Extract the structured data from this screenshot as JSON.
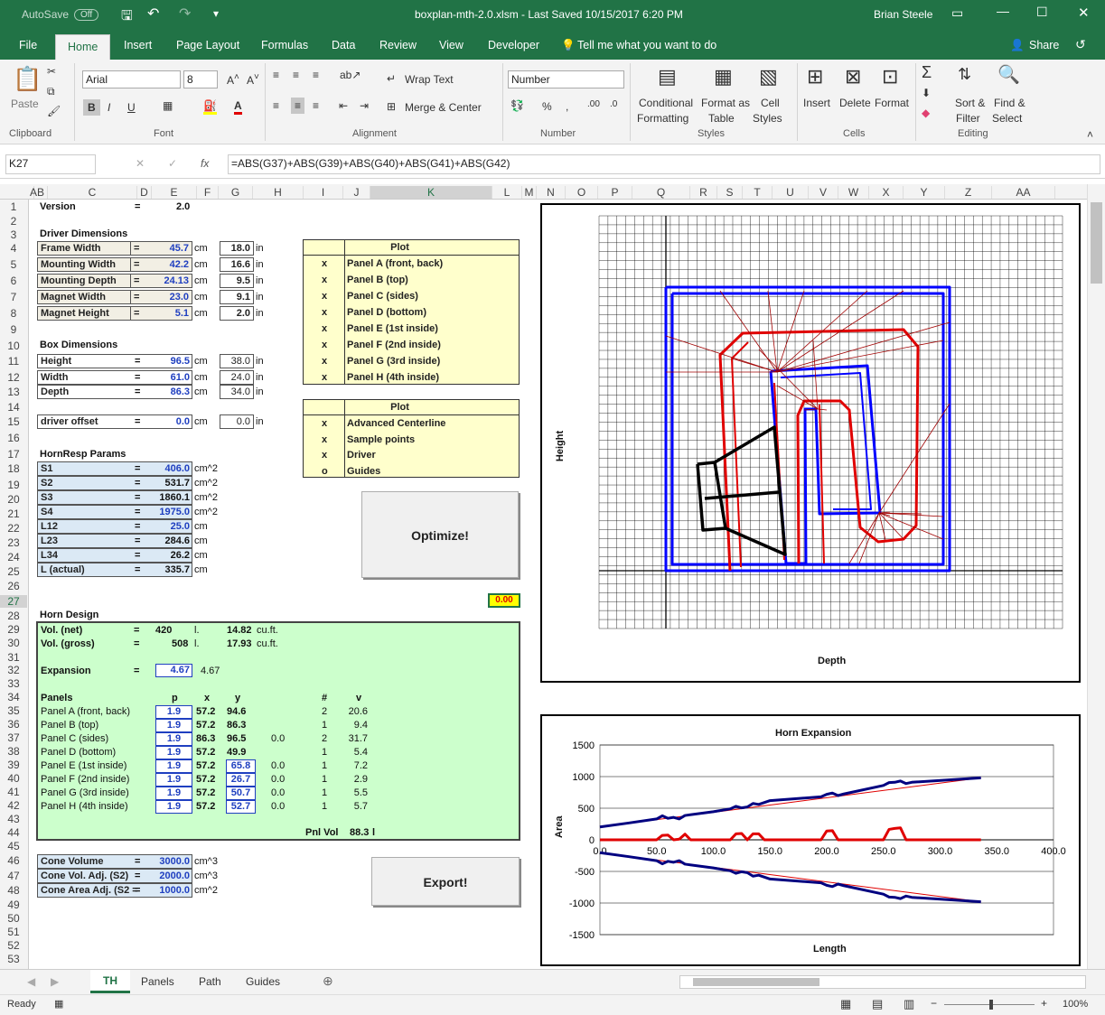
{
  "titlebar": {
    "autosave": "AutoSave",
    "autosave_state": "Off",
    "filename": "boxplan-mth-2.0.xlsm  -  Last Saved 10/15/2017 6:20 PM",
    "user": "Brian Steele"
  },
  "tabs": [
    "File",
    "Home",
    "Insert",
    "Page Layout",
    "Formulas",
    "Data",
    "Review",
    "View",
    "Developer"
  ],
  "tell_me": "Tell me what you want to do",
  "share": "Share",
  "ribbon": {
    "paste": "Paste",
    "font_name": "Arial",
    "font_size": "8",
    "wrap_text": "Wrap Text",
    "merge_center": "Merge & Center",
    "number_format": "Number",
    "conditional": "Conditional",
    "formatting": "Formatting",
    "format_as": "Format as",
    "table": "Table",
    "cell": "Cell",
    "styles_lbl": "Styles",
    "insert": "Insert",
    "delete": "Delete",
    "format": "Format",
    "sort": "Sort &",
    "filter": "Filter",
    "find": "Find &",
    "select": "Select",
    "groups": [
      "Clipboard",
      "Font",
      "Alignment",
      "Number",
      "Styles",
      "Cells",
      "Editing"
    ]
  },
  "formula": {
    "namebox": "K27",
    "fx": "fx",
    "text": "=ABS(G37)+ABS(G39)+ABS(G40)+ABS(G41)+ABS(G42)"
  },
  "columns": [
    "A",
    "B",
    "C",
    "D",
    "E",
    "F",
    "G",
    "H",
    "I",
    "J",
    "K",
    "L",
    "M",
    "N",
    "O",
    "P",
    "Q",
    "R",
    "S",
    "T",
    "U",
    "V",
    "W",
    "X",
    "Y",
    "Z",
    "AA"
  ],
  "rows": [
    "1",
    "2",
    "3",
    "4",
    "5",
    "6",
    "7",
    "8",
    "9",
    "10",
    "11",
    "12",
    "13",
    "14",
    "15",
    "16",
    "17",
    "18",
    "19",
    "20",
    "21",
    "22",
    "23",
    "24",
    "25",
    "26",
    "27",
    "28",
    "29",
    "30",
    "31",
    "32",
    "33",
    "34",
    "35",
    "36",
    "37",
    "38",
    "39",
    "40",
    "41",
    "42",
    "43",
    "44",
    "45",
    "46",
    "47",
    "48",
    "49",
    "50",
    "51",
    "52",
    "53"
  ],
  "sheet": {
    "version_lbl": "Version",
    "eq": "=",
    "version": "2.0",
    "driver_dim": "Driver Dimensions",
    "driver": [
      {
        "l": "Frame Width",
        "cm": "45.7",
        "in": "18.0"
      },
      {
        "l": "Mounting Width",
        "cm": "42.2",
        "in": "16.6"
      },
      {
        "l": "Mounting Depth",
        "cm": "24.13",
        "in": "9.5"
      },
      {
        "l": "Magnet Width",
        "cm": "23.0",
        "in": "9.1"
      },
      {
        "l": "Magnet Height",
        "cm": "5.1",
        "in": "2.0"
      }
    ],
    "cm": "cm",
    "in": "in",
    "box_dim": "Box Dimensions",
    "box": [
      {
        "l": "Height",
        "cm": "96.5",
        "in": "38.0"
      },
      {
        "l": "Width",
        "cm": "61.0",
        "in": "24.0"
      },
      {
        "l": "Depth",
        "cm": "86.3",
        "in": "34.0"
      }
    ],
    "offset": {
      "l": "driver offset",
      "cm": "0.0",
      "in": "0.0"
    },
    "hornresp": "HornResp Params",
    "hr": [
      {
        "l": "S1",
        "v": "406.0",
        "u": "cm^2"
      },
      {
        "l": "S2",
        "v": "531.7",
        "u": "cm^2"
      },
      {
        "l": "S3",
        "v": "1860.1",
        "u": "cm^2"
      },
      {
        "l": "S4",
        "v": "1975.0",
        "u": "cm^2"
      },
      {
        "l": "L12",
        "v": "25.0",
        "u": "cm"
      },
      {
        "l": "L23",
        "v": "284.6",
        "u": "cm"
      },
      {
        "l": "L34",
        "v": "26.2",
        "u": "cm"
      },
      {
        "l": "L (actual)",
        "v": "335.7",
        "u": "cm"
      }
    ],
    "plot_hdr": "Plot",
    "plot1": [
      {
        "m": "x",
        "l": "Panel A (front, back)"
      },
      {
        "m": "x",
        "l": "Panel B (top)"
      },
      {
        "m": "x",
        "l": "Panel C (sides)"
      },
      {
        "m": "x",
        "l": "Panel D (bottom)"
      },
      {
        "m": "x",
        "l": "Panel E (1st inside)"
      },
      {
        "m": "x",
        "l": "Panel F (2nd inside)"
      },
      {
        "m": "x",
        "l": "Panel G (3rd inside)"
      },
      {
        "m": "x",
        "l": "Panel H (4th inside)"
      }
    ],
    "plot2": [
      {
        "m": "x",
        "l": "Advanced Centerline"
      },
      {
        "m": "x",
        "l": "Sample points"
      },
      {
        "m": "x",
        "l": "Driver"
      },
      {
        "m": "o",
        "l": "Guides"
      }
    ],
    "optimize": "Optimize!",
    "export": "Export!",
    "k27": "0.00",
    "horn_design": "Horn Design",
    "vol_net": "Vol. (net)",
    "vol_net_l": "420",
    "vol_gross": "Vol. (gross)",
    "vol_gross_l": "508",
    "l": "l.",
    "vol_net_cf": "14.82",
    "vol_gross_cf": "17.93",
    "cuft": "cu.ft.",
    "expansion_lbl": "Expansion",
    "expansion": "4.67",
    "expansion2": "4.67",
    "panels_hdr": {
      "panels": "Panels",
      "p": "p",
      "x": "x",
      "y": "y",
      "n": "#",
      "v": "v"
    },
    "panels": [
      {
        "n": "Panel A (front, back)",
        "p": "1.9",
        "x": "57.2",
        "y": "94.6",
        "g": "",
        "c": "2",
        "v": "20.6"
      },
      {
        "n": "Panel B (top)",
        "p": "1.9",
        "x": "57.2",
        "y": "86.3",
        "g": "",
        "c": "1",
        "v": "9.4"
      },
      {
        "n": "Panel C (sides)",
        "p": "1.9",
        "x": "86.3",
        "y": "96.5",
        "g": "0.0",
        "c": "2",
        "v": "31.7"
      },
      {
        "n": "Panel D (bottom)",
        "p": "1.9",
        "x": "57.2",
        "y": "49.9",
        "g": "",
        "c": "1",
        "v": "5.4"
      },
      {
        "n": "Panel E (1st inside)",
        "p": "1.9",
        "x": "57.2",
        "y": "65.8",
        "g": "0.0",
        "c": "1",
        "v": "7.2"
      },
      {
        "n": "Panel F (2nd inside)",
        "p": "1.9",
        "x": "57.2",
        "y": "26.7",
        "g": "0.0",
        "c": "1",
        "v": "2.9"
      },
      {
        "n": "Panel G (3rd inside)",
        "p": "1.9",
        "x": "57.2",
        "y": "50.7",
        "g": "0.0",
        "c": "1",
        "v": "5.5"
      },
      {
        "n": "Panel H (4th inside)",
        "p": "1.9",
        "x": "57.2",
        "y": "52.7",
        "g": "0.0",
        "c": "1",
        "v": "5.7"
      }
    ],
    "pnl_vol": "Pnl Vol",
    "pnl_vol_v": "88.3",
    "pnl_vol_u": "l",
    "cone": [
      {
        "l": "Cone Volume",
        "v": "3000.0",
        "u": "cm^3"
      },
      {
        "l": "Cone Vol. Adj. (S2)",
        "v": "2000.0",
        "u": "cm^3"
      },
      {
        "l": "Cone Area Adj. (S2 =",
        "v": "1000.0",
        "u": "cm^2"
      }
    ]
  },
  "chart1": {
    "xlabel": "Depth",
    "ylabel": "Height"
  },
  "chart_data": {
    "type": "line",
    "title": "Horn Expansion",
    "xlabel": "Length",
    "ylabel": "Area",
    "xlim": [
      0,
      400
    ],
    "ylim": [
      -1500,
      1500
    ],
    "x_ticks": [
      "0.0",
      "50.0",
      "100.0",
      "150.0",
      "200.0",
      "250.0",
      "300.0",
      "350.0",
      "400.0"
    ],
    "y_ticks": [
      "1500",
      "1000",
      "500",
      "0",
      "-500",
      "-1000",
      "-1500"
    ],
    "series": [
      {
        "color": "#000080",
        "x": [
          0,
          25,
          50,
          55,
          60,
          65,
          70,
          75,
          100,
          115,
          120,
          125,
          130,
          135,
          140,
          150,
          195,
          200,
          205,
          210,
          215,
          250,
          255,
          260,
          265,
          270,
          275,
          336
        ],
        "y": [
          203,
          265,
          330,
          380,
          340,
          355,
          330,
          385,
          445,
          490,
          530,
          505,
          520,
          575,
          560,
          620,
          680,
          720,
          740,
          700,
          725,
          860,
          905,
          910,
          930,
          890,
          910,
          980
        ]
      },
      {
        "color": "#e00000",
        "x": [
          0,
          50,
          55,
          60,
          65,
          70,
          75,
          80,
          115,
          120,
          125,
          130,
          135,
          140,
          145,
          195,
          200,
          205,
          210,
          215,
          250,
          255,
          260,
          265,
          270,
          336
        ],
        "y": [
          0,
          0,
          70,
          75,
          0,
          10,
          90,
          0,
          0,
          95,
          100,
          0,
          95,
          95,
          0,
          0,
          140,
          145,
          0,
          0,
          0,
          165,
          180,
          190,
          0,
          0
        ]
      }
    ]
  },
  "sheet_tabs": [
    "TH",
    "Panels",
    "Path",
    "Guides"
  ],
  "status": {
    "ready": "Ready",
    "zoom": "100%"
  },
  "colors": {
    "excel_green": "#217346",
    "horn_fill": "#ccffcc",
    "plot_fill": "#ffffcc",
    "blue": "#0000ff",
    "red": "#e00000"
  }
}
